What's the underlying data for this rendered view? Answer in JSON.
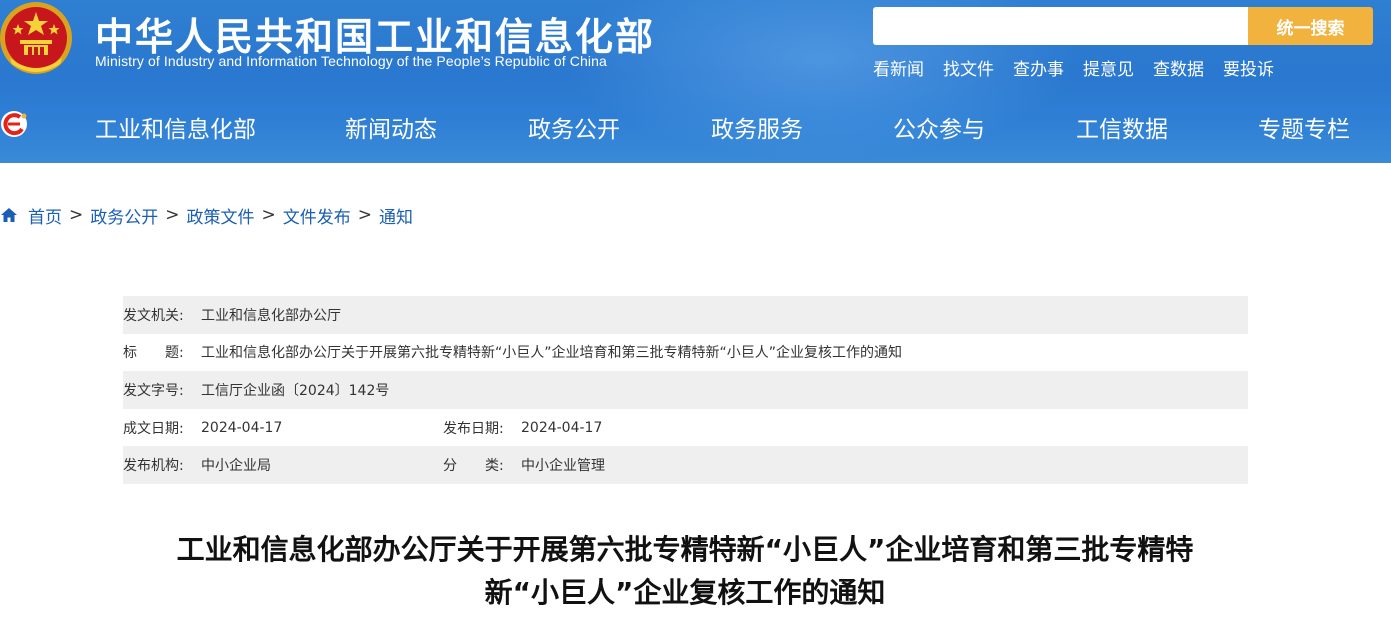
{
  "header": {
    "title": "中华人民共和国工业和信息化部",
    "subtitle": "Ministry of Industry and Information Technology of the People’s Republic of China",
    "search": {
      "placeholder": "",
      "button_label": "统一搜索"
    },
    "quick_links": [
      "看新闻",
      "找文件",
      "查办事",
      "提意见",
      "查数据",
      "要投诉"
    ]
  },
  "nav": {
    "items": [
      "工业和信息化部",
      "新闻动态",
      "政务公开",
      "政务服务",
      "公众参与",
      "工信数据",
      "专题专栏"
    ]
  },
  "breadcrumb": {
    "items": [
      "首页",
      "政务公开",
      "政策文件",
      "文件发布",
      "通知"
    ],
    "separator": ">"
  },
  "meta": {
    "issuer_label": "发文机关:",
    "issuer": "工业和信息化部办公厅",
    "title_label": "标　　题:",
    "title": "工业和信息化部办公厅关于开展第六批专精特新“小巨人”企业培育和第三批专精特新“小巨人”企业复核工作的通知",
    "doc_no_label": "发文字号:",
    "doc_no": "工信厅企业函〔2024〕142号",
    "written_date_label": "成文日期:",
    "written_date": "2024-04-17",
    "publish_date_label": "发布日期:",
    "publish_date": "2024-04-17",
    "org_label": "发布机构:",
    "org": "中小企业局",
    "category_label": "分　　类:",
    "category": "中小企业管理"
  },
  "document": {
    "title_line1": "工业和信息化部办公厅关于开展第六批专精特新“小巨人”企业培育和第三批专精特",
    "title_line2": "新“小巨人”企业复核工作的通知"
  },
  "colors": {
    "header_blue": "#2a78cf",
    "search_button": "#f2b23e",
    "link_blue": "#1a5fb4",
    "row_shade": "#efefef"
  },
  "icons": [
    "national-emblem-icon",
    "site-logo-icon",
    "home-icon"
  ]
}
